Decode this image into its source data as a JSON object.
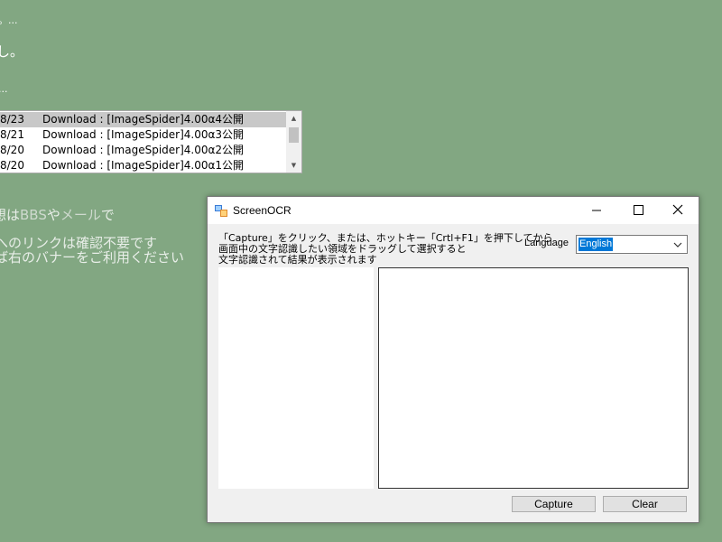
{
  "background": {
    "line1": "。...",
    "line2": "し。",
    "line3": "...",
    "line4_a": "想は",
    "line4_b": "BBS",
    "line4_c": "や",
    "line4_d": "メール",
    "line4_e": "で",
    "line5": "へのリンクは確認不要です",
    "line6": "ば右のバナーをご利用ください",
    "list": [
      {
        "date": "8/23",
        "text": "Download : [ImageSpider]4.00α4公開",
        "selected": true
      },
      {
        "date": "8/21",
        "text": "Download : [ImageSpider]4.00α3公開",
        "selected": false
      },
      {
        "date": "8/20",
        "text": "Download : [ImageSpider]4.00α2公開",
        "selected": false
      },
      {
        "date": "8/20",
        "text": "Download : [ImageSpider]4.00α1公開",
        "selected": false
      }
    ]
  },
  "window": {
    "title": "ScreenOCR",
    "icon": "screenocr-app-icon",
    "instructions": [
      "「Capture」をクリック、または、ホットキー「Crtl+F1」を押下してから",
      "画面中の文字認識したい領域をドラッグして選択すると",
      "文字認識されて結果が表示されます"
    ],
    "language_label": "Language",
    "language_value": "English",
    "capture_label": "Capture",
    "clear_label": "Clear",
    "accent_color": "#0078d7"
  }
}
